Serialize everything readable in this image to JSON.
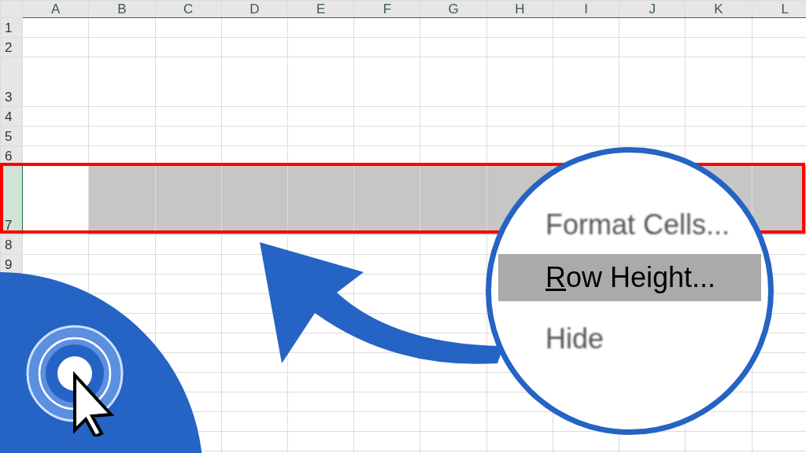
{
  "columns": [
    "A",
    "B",
    "C",
    "D",
    "E",
    "F",
    "G",
    "H",
    "I",
    "J",
    "K",
    "L"
  ],
  "rows": [
    {
      "number": "1",
      "tall": false,
      "selected": false
    },
    {
      "number": "2",
      "tall": false,
      "selected": false
    },
    {
      "number": "3",
      "tall": true,
      "selected": false
    },
    {
      "number": "4",
      "tall": false,
      "selected": false
    },
    {
      "number": "5",
      "tall": false,
      "selected": false
    },
    {
      "number": "6",
      "tall": false,
      "selected": false
    },
    {
      "number": "7",
      "tall": true,
      "selected": true
    },
    {
      "number": "8",
      "tall": false,
      "selected": false
    },
    {
      "number": "9",
      "tall": false,
      "selected": false
    }
  ],
  "magnifier": {
    "menu_items": [
      {
        "label": "Format Cells...",
        "selected": false,
        "mnemonic_underlined": false
      },
      {
        "label": "Row Height...",
        "selected": true,
        "mnemonic_underlined": true
      },
      {
        "label": "Hide",
        "selected": false,
        "mnemonic_underlined": false
      }
    ]
  }
}
